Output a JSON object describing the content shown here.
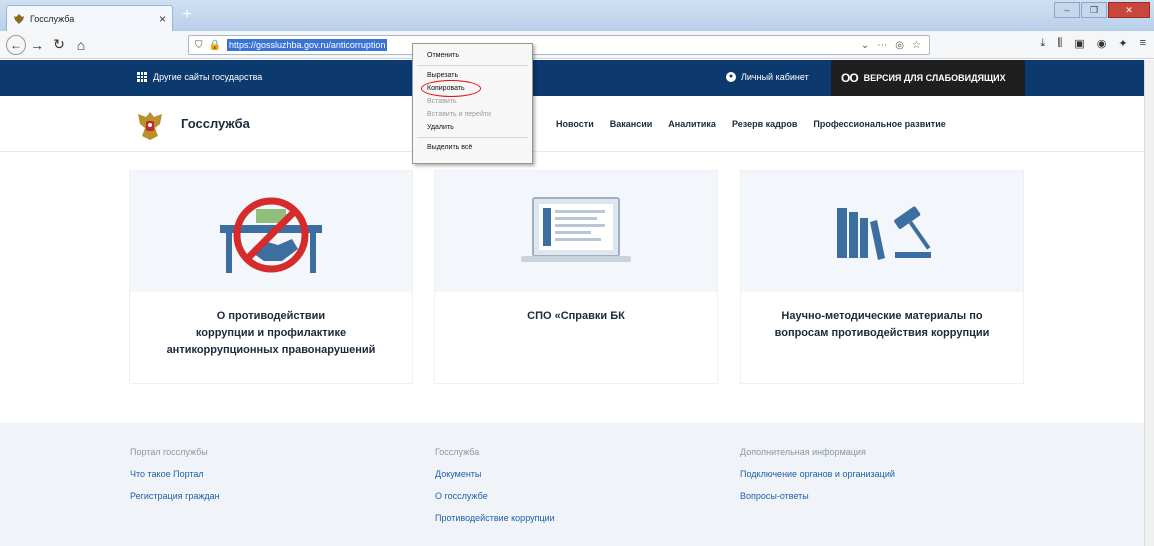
{
  "browser": {
    "tab_title": "Госслужба",
    "tab_close": "×",
    "new_tab": "+",
    "url": "https://gossluzhba.gov.ru/anticorruption",
    "window_controls": [
      "–",
      "❐",
      "✕"
    ]
  },
  "topbar": {
    "other_sites": "Другие сайты государства",
    "cabinet": "Личный кабинет",
    "low_vision": "ВЕРСИЯ ДЛЯ СЛАБОВИДЯЩИХ"
  },
  "site": {
    "logo_text": "Госслужба",
    "nav": [
      "Новости",
      "Вакансии",
      "Аналитика",
      "Резерв кадров",
      "Профессиональное развитие"
    ]
  },
  "cards": [
    {
      "title_lines": [
        "О противодействии",
        "коррупции и профилактике",
        "антикоррупционных правонарушений"
      ]
    },
    {
      "title_lines": [
        "СПО «Справки БК"
      ]
    },
    {
      "title_lines": [
        "Научно-методические материалы по",
        "вопросам противодействия коррупции"
      ]
    }
  ],
  "footer": {
    "col1": {
      "head": "Портал госслужбы",
      "links": [
        "Что такое Портал",
        "Регистрация граждан"
      ]
    },
    "col2": {
      "head": "Госслужба",
      "links": [
        "Документы",
        "О госслужбе",
        "Противодействие коррупции"
      ]
    },
    "col3": {
      "head": "Дополнительная информация",
      "links": [
        "Подключение органов и организаций",
        "Вопросы-ответы"
      ]
    }
  },
  "context_menu": {
    "items": [
      {
        "label": "Отменить",
        "disabled": false
      },
      {
        "sep": true
      },
      {
        "label": "Вырезать",
        "disabled": false
      },
      {
        "label": "Копировать",
        "disabled": false,
        "highlight": true
      },
      {
        "label": "Вставить",
        "disabled": true
      },
      {
        "label": "Вставить и перейти",
        "disabled": true
      },
      {
        "label": "Удалить",
        "disabled": false
      },
      {
        "sep": true
      },
      {
        "label": "Выделить всё",
        "disabled": false
      }
    ]
  },
  "colors": {
    "brand_blue": "#0c3a6f",
    "link_blue": "#1f5fa8",
    "highlight_red": "#dd1111"
  }
}
